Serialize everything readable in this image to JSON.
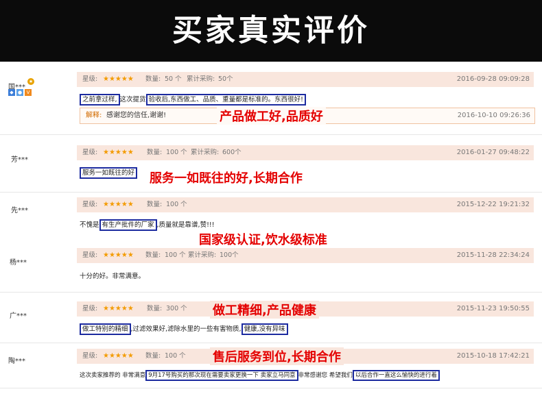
{
  "banner": {
    "title": "买家真实评价"
  },
  "labels": {
    "rating": "星级:",
    "quantity": "数量:",
    "cumulative": "累计采购:",
    "stars": "★★★★★",
    "reply": "解释:"
  },
  "reviews": [
    {
      "user": "国***",
      "quantity": "50 个",
      "cumulative": "50个",
      "date": "2016-09-28 09:09:28",
      "content": {
        "boxed1": "之前拿过样,",
        "plain1": "这次提货",
        "boxed2": "验收后,东西做工、品质、重量都是标准的。东西很好!"
      },
      "reply": {
        "text": "感谢您的信任,谢谢!",
        "date": "2016-10-10 09:26:36"
      },
      "note": "产品做工好,品质好"
    },
    {
      "user": "芳***",
      "quantity": "100 个",
      "cumulative": "600个",
      "date": "2016-01-27 09:48:22",
      "content": {
        "boxed1": "服务一如既往的好"
      },
      "note": "服务一如既往的好,长期合作"
    },
    {
      "user": "先***",
      "quantity": "100 个",
      "date": "2015-12-22 19:21:32",
      "content": {
        "plain1": "不愧是",
        "boxed1": "有生产批件的厂家",
        "plain2": ",质量就是靠谱,赞!!!"
      },
      "note": "国家级认证,饮水级标准"
    },
    {
      "user": "杨***",
      "quantity": "100 个",
      "cumulative": "100个",
      "date": "2015-11-28 22:34:24",
      "content": {
        "plain1": "十分的好。非常满意。"
      }
    },
    {
      "user": "广***",
      "quantity": "300 个",
      "date": "2015-11-23 19:50:55",
      "content": {
        "boxed1": "做工特别的精细",
        "plain1": ",过滤效果好,滤除水里的一些有害物质,",
        "boxed2": "健康,没有异味"
      },
      "note": "做工精细,产品健康"
    },
    {
      "user": "陶***",
      "quantity": "100 个",
      "date": "2015-10-18 17:42:21",
      "content": {
        "plain1": "这次卖家推荐的 非常满意",
        "boxed1": "9月17号购买的那次现在需要卖家更换一下 卖家立马同意",
        "plain2": "非常感谢您 希望我们",
        "boxed2": "以后合作一直这么愉快的进行着"
      },
      "note": "售后服务到位,长期合作"
    }
  ]
}
